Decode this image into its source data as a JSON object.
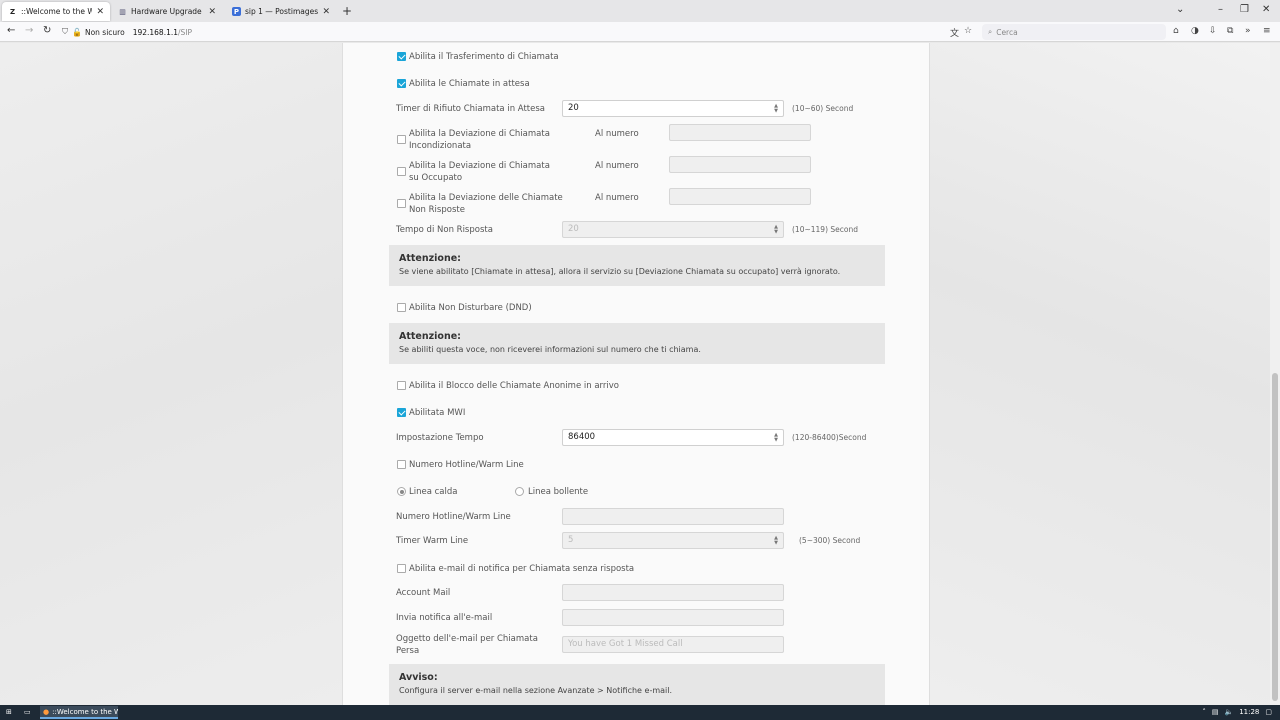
{
  "browser": {
    "tabs": [
      {
        "title": "::Welcome to the Web-Based C",
        "favicon": "Z",
        "active": true
      },
      {
        "title": "Hardware Upgrade Forum - Re",
        "favicon": "▥",
        "active": false
      },
      {
        "title": "sip 1 — Postimages",
        "favicon": "P",
        "active": false
      }
    ],
    "new_tab": "+",
    "security_label": "Non sicuro",
    "url_host": "192.168.1.1",
    "url_path": "/SIP",
    "search_placeholder": "Cerca"
  },
  "form": {
    "call_transfer": {
      "label": "Abilita il Trasferimento di Chiamata",
      "checked": true
    },
    "call_waiting": {
      "label": "Abilita le Chiamate in attesa",
      "checked": true
    },
    "waiting_reject_timer": {
      "label": "Timer di Rifiuto Chiamata in Attesa",
      "value": "20",
      "unit": "(10~60) Second"
    },
    "cfu": {
      "label": "Abilita la Deviazione di Chiamata Incondizionata",
      "number_label": "Al numero",
      "checked": false
    },
    "cfb": {
      "label": "Abilita la Deviazione di Chiamata su Occupato",
      "number_label": "Al numero",
      "checked": false
    },
    "cfnr": {
      "label": "Abilita la Deviazione delle Chiamate Non Risposte",
      "number_label": "Al numero",
      "checked": false
    },
    "no_answer_time": {
      "label": "Tempo di Non Risposta",
      "value": "20",
      "unit": "(10~119) Second"
    },
    "note1": {
      "title": "Attenzione:",
      "text": "Se viene abilitato [Chiamate in attesa], allora il servizio su [Deviazione Chiamata su occupato] verrà ignorato."
    },
    "dnd": {
      "label": "Abilita Non Disturbare (DND)",
      "checked": false
    },
    "note2": {
      "title": "Attenzione:",
      "text": "Se abiliti questa voce, non riceverei informazioni sul numero che ti chiama."
    },
    "anon_block": {
      "label": "Abilita il Blocco delle Chiamate Anonime in arrivo",
      "checked": false
    },
    "mwi": {
      "label": "Abilitata MWI",
      "checked": true
    },
    "time_setting": {
      "label": "Impostazione Tempo",
      "value": "86400",
      "unit": "(120-86400)Second"
    },
    "hotline_enable": {
      "label": "Numero Hotline/Warm Line",
      "checked": false
    },
    "line_hot": {
      "label": "Linea calda",
      "selected": true
    },
    "line_warm": {
      "label": "Linea bollente",
      "selected": false
    },
    "hotline_number": {
      "label": "Numero Hotline/Warm Line",
      "value": ""
    },
    "warm_timer": {
      "label": "Timer Warm Line",
      "value": "5",
      "unit": "(5~300) Second"
    },
    "missed_email": {
      "label": "Abilita e-mail di notifica per Chiamata senza risposta",
      "checked": false
    },
    "mail_account": {
      "label": "Account Mail",
      "value": ""
    },
    "notify_email": {
      "label": "Invia notifica all'e-mail",
      "value": ""
    },
    "email_subject": {
      "label": "Oggetto dell'e-mail per Chiamata Persa",
      "value": "You have Got 1 Missed Call"
    },
    "note3": {
      "title": "Avviso:",
      "text": "Configura il server e-mail nella sezione Avanzate > Notifiche e-mail."
    }
  },
  "taskbar": {
    "item": "::Welcome to the We...",
    "time": "11:28"
  },
  "colors": {
    "accent": "#1aa5d8",
    "note_bg": "#e6e6e6"
  }
}
